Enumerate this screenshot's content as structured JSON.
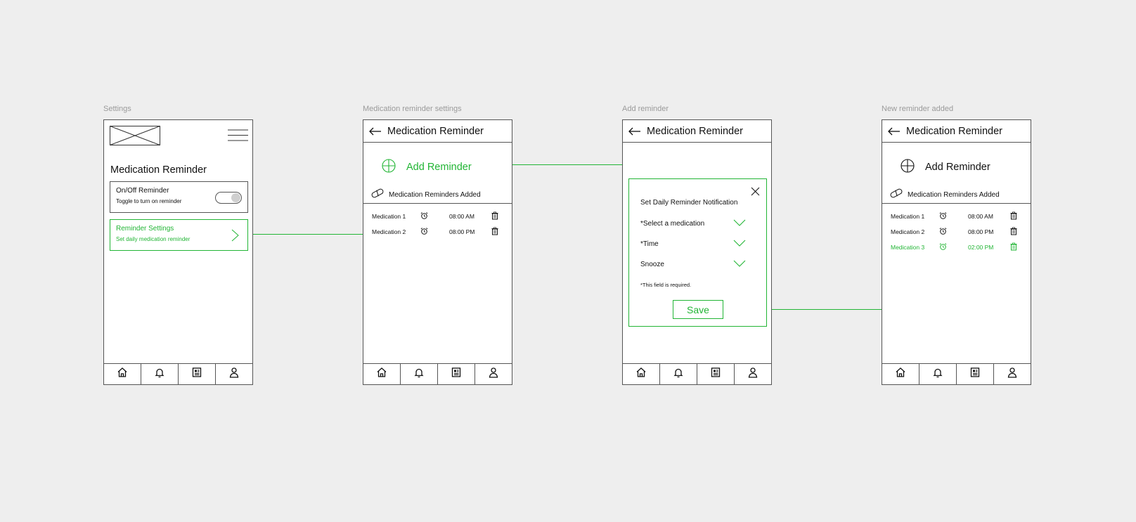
{
  "frames": {
    "settings": {
      "label": "Settings"
    },
    "medication_reminder_settings": {
      "label": "Medication reminder settings"
    },
    "add_reminder": {
      "label": "Add reminder"
    },
    "new_reminder_added": {
      "label": "New reminder added"
    }
  },
  "colors": {
    "accent": "#22b535",
    "border": "#555555",
    "background": "#eeeeee",
    "label": "#9a9a9a"
  },
  "settings_screen": {
    "title": "Medication Reminder",
    "toggle_card": {
      "title": "On/Off Reminder",
      "subtitle": "Toggle to turn on reminder",
      "toggle_state": "off"
    },
    "settings_card": {
      "title": "Reminder Settings",
      "subtitle": "Set daily medication reminder"
    },
    "icons": [
      "image-placeholder-icon",
      "hamburger-menu-icon",
      "chevron-right-icon"
    ]
  },
  "appbar": {
    "title": "Medication Reminder"
  },
  "reminder_list_screen": {
    "add_label": "Add Reminder",
    "added_label": "Medication Reminders Added",
    "reminders": [
      {
        "name": "Medication 1",
        "time": "08:00 AM"
      },
      {
        "name": "Medication 2",
        "time": "08:00 PM"
      }
    ]
  },
  "add_reminder_screen": {
    "dialog_title": "Set Daily Reminder Notification",
    "fields": [
      {
        "label": "*Select a medication"
      },
      {
        "label": "*Time"
      },
      {
        "label": "Snooze"
      }
    ],
    "required_note": "*This field is required.",
    "save_label": "Save"
  },
  "new_reminder_screen": {
    "add_label": "Add Reminder",
    "added_label": "Medication Reminders Added",
    "reminders": [
      {
        "name": "Medication 1",
        "time": "08:00 AM",
        "highlight": false
      },
      {
        "name": "Medication 2",
        "time": "08:00 PM",
        "highlight": false
      },
      {
        "name": "Medication 3",
        "time": "02:00 PM",
        "highlight": true
      }
    ]
  },
  "bottom_nav": [
    "home-icon",
    "bell-icon",
    "news-icon",
    "profile-icon"
  ]
}
